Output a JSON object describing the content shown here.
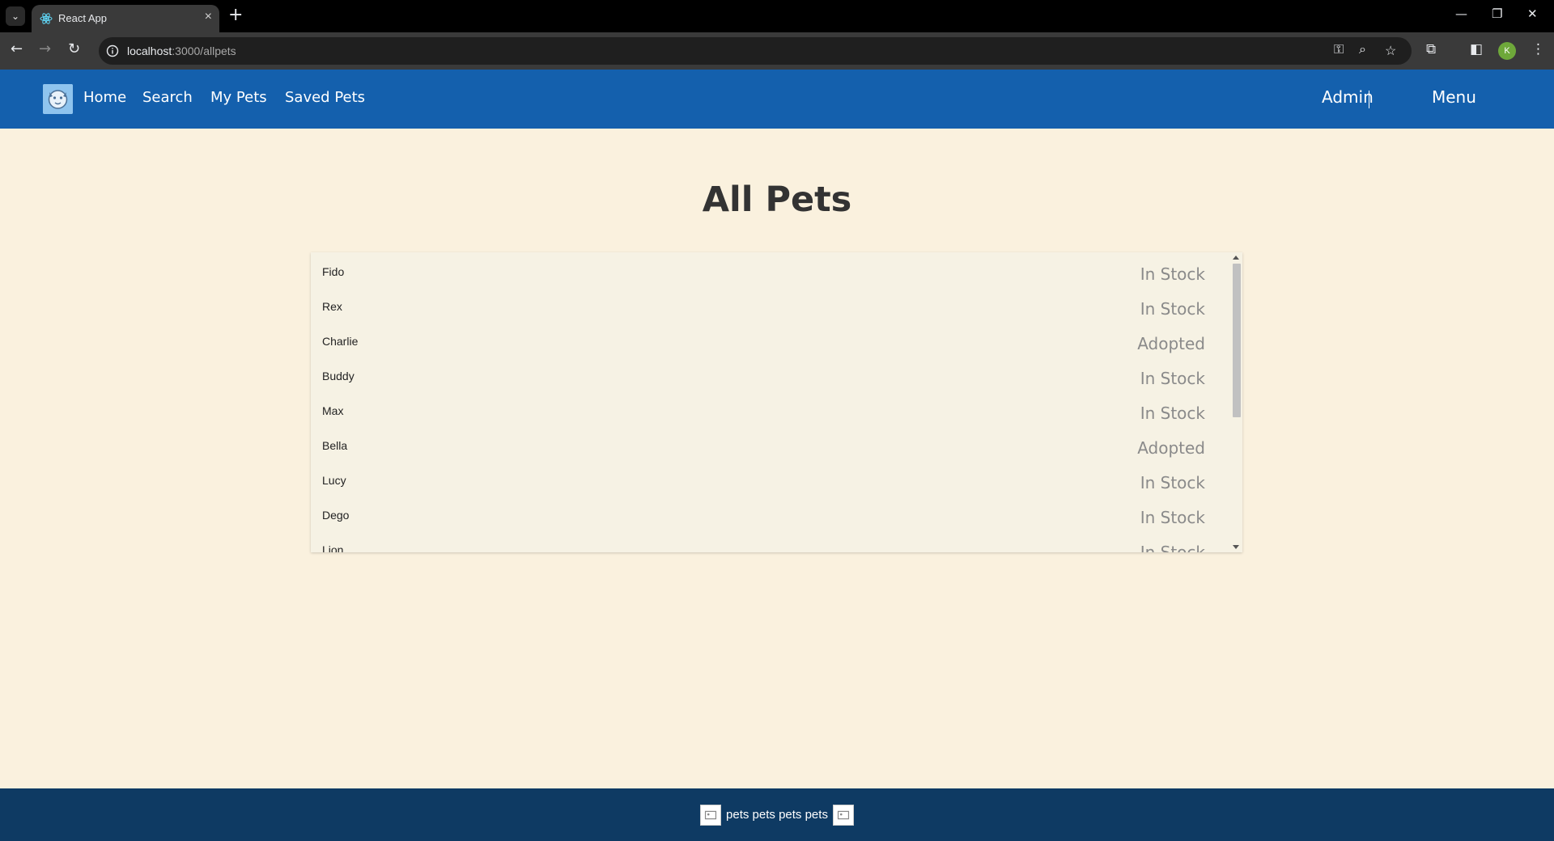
{
  "browser": {
    "tab_title": "React App",
    "url_host": "localhost",
    "url_path": ":3000/allpets",
    "profile_initial": "K"
  },
  "header": {
    "nav": [
      "Home",
      "Search",
      "My Pets",
      "Saved Pets"
    ],
    "admin_label": "Admin",
    "menu_label": "Menu"
  },
  "page": {
    "title": "All Pets",
    "pets": [
      {
        "name": "Fido",
        "status": "In Stock"
      },
      {
        "name": "Rex",
        "status": "In Stock"
      },
      {
        "name": "Charlie",
        "status": "Adopted"
      },
      {
        "name": "Buddy",
        "status": "In Stock"
      },
      {
        "name": "Max",
        "status": "In Stock"
      },
      {
        "name": "Bella",
        "status": "Adopted"
      },
      {
        "name": "Lucy",
        "status": "In Stock"
      },
      {
        "name": "Dego",
        "status": "In Stock"
      },
      {
        "name": "Lion",
        "status": "In Stock"
      }
    ]
  },
  "footer": {
    "text": "pets pets pets pets"
  },
  "colors": {
    "header_bg": "#1460ad",
    "footer_bg": "#0e3a63",
    "page_bg": "#faf1de",
    "status_text": "#8a8a8a"
  }
}
